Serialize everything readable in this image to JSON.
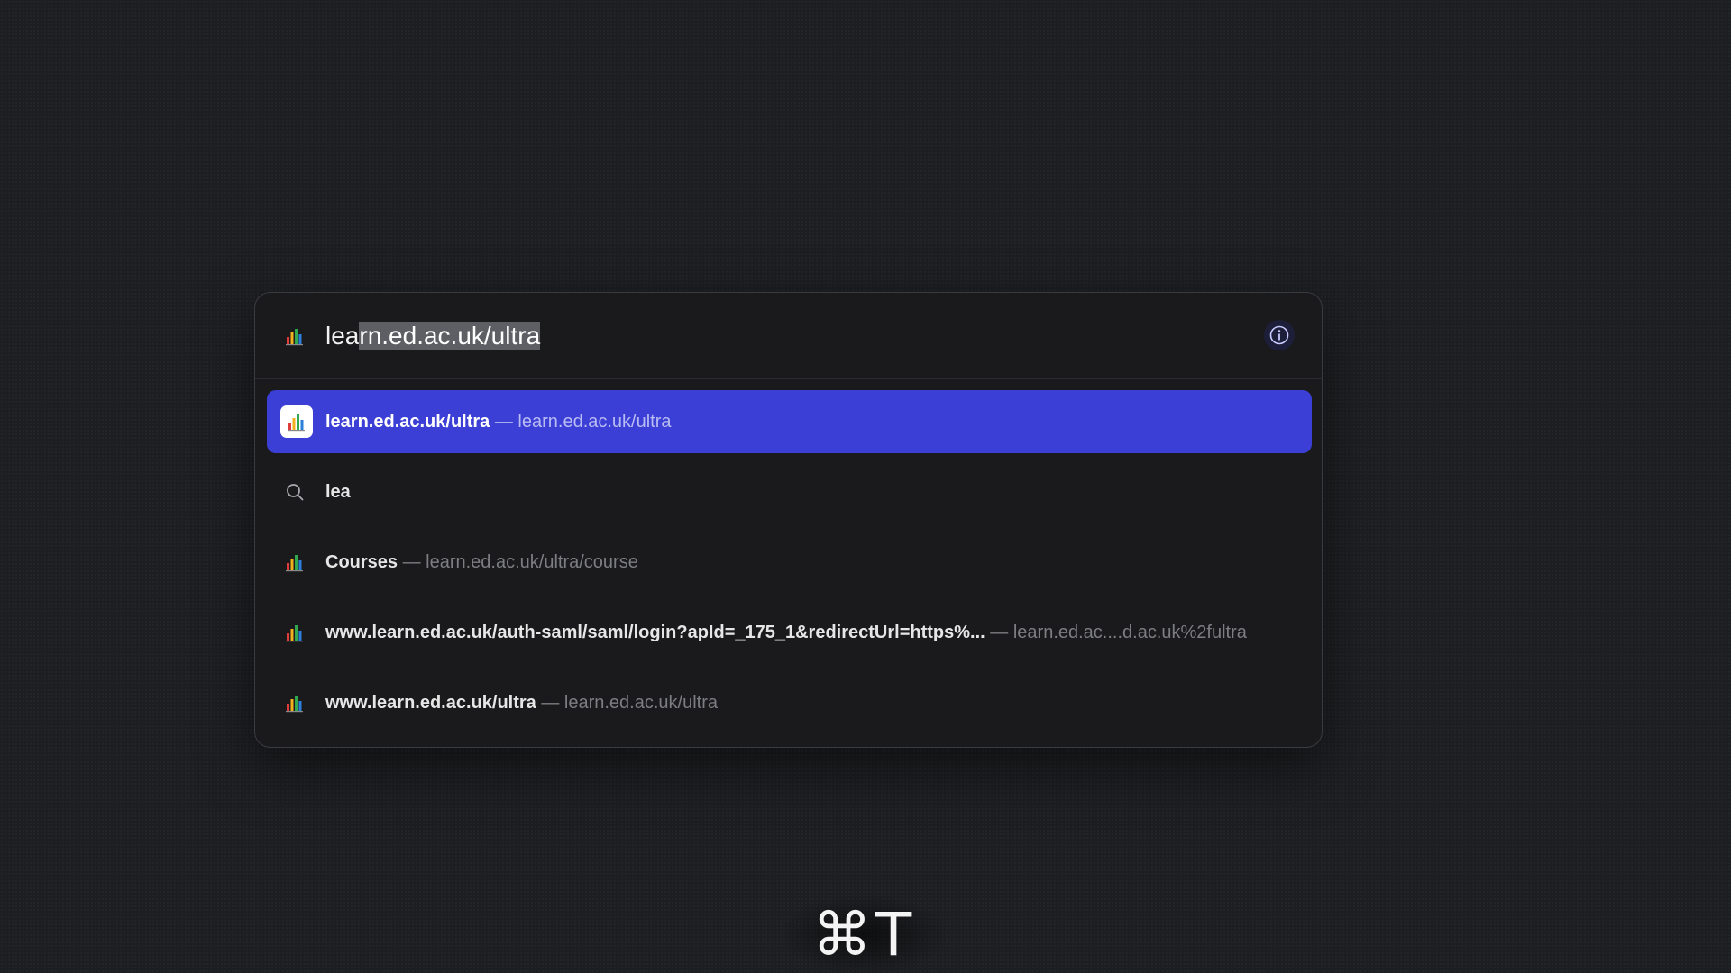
{
  "address_bar": {
    "typed": "lea",
    "autocomplete": "rn.ed.ac.uk/ultra",
    "favicon": "bar-chart-favicon"
  },
  "suggestions": [
    {
      "type": "site",
      "title": "learn.ed.ac.uk/ultra",
      "separator": "—",
      "url": "learn.ed.ac.uk/ultra",
      "selected": true,
      "icon": "bar-chart-favicon"
    },
    {
      "type": "search",
      "title": "lea",
      "icon": "search-icon"
    },
    {
      "type": "site",
      "title": "Courses",
      "separator": "—",
      "url": "learn.ed.ac.uk/ultra/course",
      "icon": "bar-chart-favicon"
    },
    {
      "type": "site",
      "title": "www.learn.ed.ac.uk/auth-saml/saml/login?apId=_175_1&redirectUrl=https%...",
      "separator": "—",
      "url": "learn.ed.ac....d.ac.uk%2fultra",
      "icon": "bar-chart-favicon"
    },
    {
      "type": "site",
      "title": "www.learn.ed.ac.uk/ultra",
      "separator": "—",
      "url": "learn.ed.ac.uk/ultra",
      "icon": "bar-chart-favicon"
    }
  ],
  "shortcut_hint": "⌘T",
  "colors": {
    "selected_row": "#3b3fd6",
    "background": "#1d1e21",
    "panel": "#1a1a1c"
  }
}
